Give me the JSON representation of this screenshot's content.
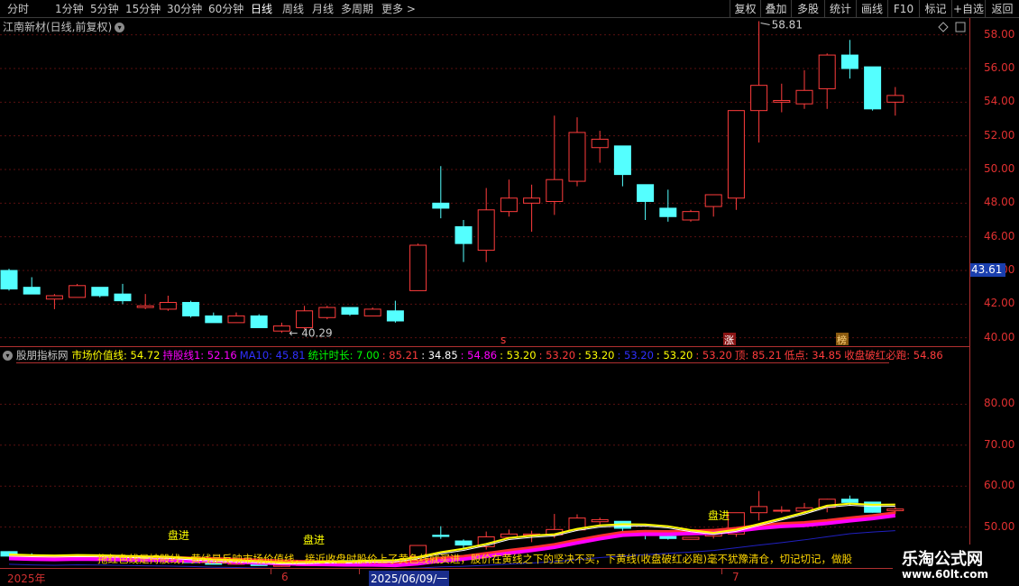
{
  "toolbar": {
    "periods": [
      "分时",
      "1分钟",
      "5分钟",
      "15分钟",
      "30分钟",
      "60分钟",
      "日线",
      "周线",
      "月线",
      "多周期",
      "更多 >"
    ],
    "active_period": "日线",
    "buttons": [
      "复权",
      "叠加",
      "多股",
      "统计",
      "画线",
      "F10",
      "标记",
      "+自选",
      "返回"
    ]
  },
  "chart_title": "江南新材(日线,前复权)",
  "icons": {
    "dropdown": "chevron-down-icon",
    "diamond": "diamond-icon",
    "square": "square-icon"
  },
  "colors": {
    "up": "#ff3c3c",
    "down": "#54ffff",
    "axis": "#e03030",
    "yellow": "#ffff00",
    "magenta": "#ff00ff",
    "cyan": "#54ffff"
  },
  "price_axis": [
    "58.00",
    "56.00",
    "54.00",
    "52.00",
    "50.00",
    "48.00",
    "46.00",
    "44.00",
    "42.00",
    "40.00"
  ],
  "current_price": "43.61",
  "annotations": {
    "high_label": "58.81",
    "low_label": "40.29",
    "marker_s": "s",
    "marker_zhang": "涨",
    "marker_bang": "榜"
  },
  "indicator": {
    "name": "股朋指标网",
    "items": [
      {
        "text": "市场价值线: 54.72",
        "color": "#ffff00"
      },
      {
        "text": "持股线1: 52.16",
        "color": "#ff00ff"
      },
      {
        "text": "MA10: 45.81",
        "color": "#3030ff"
      },
      {
        "text": "统计时长: 7.00",
        "color": "#00ff00"
      },
      {
        "text": ": 85.21",
        "color": "#ff3c3c"
      },
      {
        "text": ": 34.85",
        "color": "#ffffff"
      },
      {
        "text": ": 54.86",
        "color": "#ff00ff"
      },
      {
        "text": ": 53.20",
        "color": "#ffff00"
      },
      {
        "text": ": 53.20",
        "color": "#ff3c3c"
      },
      {
        "text": ": 53.20",
        "color": "#ffff00"
      },
      {
        "text": ": 53.20",
        "color": "#3030ff"
      },
      {
        "text": ": 53.20",
        "color": "#ffff00"
      },
      {
        "text": ": 53.20",
        "color": "#ff3c3c"
      },
      {
        "text": "顶: 85.21",
        "color": "#ff3c3c"
      },
      {
        "text": "低点: 34.85",
        "color": "#ff3c3c"
      },
      {
        "text": "收盘破红必跑: 54.86",
        "color": "#ff3c3c"
      }
    ]
  },
  "lower_axis": [
    "80.00",
    "70.00",
    "60.00",
    "50.00"
  ],
  "lower_labels": {
    "buy": "进",
    "hold": "短",
    "wait": "盘进"
  },
  "ticker_text": "拖红色线是持股线，黄线是反映市场价值线，接近收盘时股价上了黄色线就买进，股价在黄线之下的坚决不买，下黄线(收盘破红必跑)毫不犹豫清仓，切记切记，做股",
  "date_axis": [
    "2025年",
    "6",
    "2025/06/09/一",
    "7"
  ],
  "watermark": {
    "site_name": "乐淘公式网",
    "site_url": "www.60lt.com"
  },
  "chart_data": {
    "type": "candlestick",
    "title": "江南新材(日线,前复权)",
    "ylim": [
      39.5,
      59.0
    ],
    "candles": [
      {
        "o": 44.0,
        "h": 44.1,
        "l": 42.8,
        "c": 42.9
      },
      {
        "o": 43.0,
        "h": 43.6,
        "l": 42.6,
        "c": 42.6
      },
      {
        "o": 42.3,
        "h": 42.6,
        "l": 41.7,
        "c": 42.5
      },
      {
        "o": 42.4,
        "h": 43.2,
        "l": 42.4,
        "c": 43.1
      },
      {
        "o": 43.0,
        "h": 43.0,
        "l": 42.4,
        "c": 42.5
      },
      {
        "o": 42.6,
        "h": 43.2,
        "l": 42.0,
        "c": 42.2
      },
      {
        "o": 41.8,
        "h": 42.6,
        "l": 41.7,
        "c": 41.9
      },
      {
        "o": 41.7,
        "h": 42.5,
        "l": 41.6,
        "c": 42.1
      },
      {
        "o": 42.1,
        "h": 42.2,
        "l": 41.2,
        "c": 41.3
      },
      {
        "o": 41.3,
        "h": 41.5,
        "l": 40.9,
        "c": 40.9
      },
      {
        "o": 40.9,
        "h": 41.5,
        "l": 40.9,
        "c": 41.3
      },
      {
        "o": 41.3,
        "h": 41.4,
        "l": 40.6,
        "c": 40.6
      },
      {
        "o": 40.4,
        "h": 40.9,
        "l": 40.29,
        "c": 40.7
      },
      {
        "o": 40.6,
        "h": 41.9,
        "l": 40.5,
        "c": 41.6
      },
      {
        "o": 41.2,
        "h": 41.9,
        "l": 41.1,
        "c": 41.8
      },
      {
        "o": 41.8,
        "h": 41.8,
        "l": 41.3,
        "c": 41.4
      },
      {
        "o": 41.3,
        "h": 41.8,
        "l": 41.3,
        "c": 41.7
      },
      {
        "o": 41.6,
        "h": 42.2,
        "l": 40.9,
        "c": 41.0
      },
      {
        "o": 42.8,
        "h": 45.6,
        "l": 42.8,
        "c": 45.5
      },
      {
        "o": 48.0,
        "h": 50.2,
        "l": 47.1,
        "c": 47.7
      },
      {
        "o": 46.6,
        "h": 47.0,
        "l": 44.5,
        "c": 45.6
      },
      {
        "o": 45.2,
        "h": 48.9,
        "l": 44.5,
        "c": 47.6
      },
      {
        "o": 47.5,
        "h": 49.4,
        "l": 47.2,
        "c": 48.3
      },
      {
        "o": 48.0,
        "h": 49.1,
        "l": 46.3,
        "c": 48.3
      },
      {
        "o": 48.1,
        "h": 53.2,
        "l": 47.3,
        "c": 49.4
      },
      {
        "o": 49.3,
        "h": 53.1,
        "l": 49.0,
        "c": 52.2
      },
      {
        "o": 51.3,
        "h": 52.3,
        "l": 50.4,
        "c": 51.8
      },
      {
        "o": 51.4,
        "h": 51.4,
        "l": 49.0,
        "c": 49.7
      },
      {
        "o": 49.1,
        "h": 49.1,
        "l": 47.0,
        "c": 48.1
      },
      {
        "o": 47.7,
        "h": 48.8,
        "l": 46.9,
        "c": 47.2
      },
      {
        "o": 47.0,
        "h": 47.6,
        "l": 46.9,
        "c": 47.5
      },
      {
        "o": 47.8,
        "h": 48.1,
        "l": 47.2,
        "c": 48.5
      },
      {
        "o": 48.3,
        "h": 53.3,
        "l": 47.6,
        "c": 53.5
      },
      {
        "o": 53.5,
        "h": 58.81,
        "l": 51.6,
        "c": 55.0
      },
      {
        "o": 54.0,
        "h": 55.1,
        "l": 53.4,
        "c": 54.1
      },
      {
        "o": 53.9,
        "h": 55.9,
        "l": 53.6,
        "c": 54.7
      },
      {
        "o": 54.8,
        "h": 56.9,
        "l": 53.6,
        "c": 56.8
      },
      {
        "o": 56.8,
        "h": 57.7,
        "l": 55.4,
        "c": 56.0
      },
      {
        "o": 56.1,
        "h": 56.1,
        "l": 53.5,
        "c": 53.6
      },
      {
        "o": 54.0,
        "h": 54.9,
        "l": 53.2,
        "c": 54.4
      }
    ]
  }
}
